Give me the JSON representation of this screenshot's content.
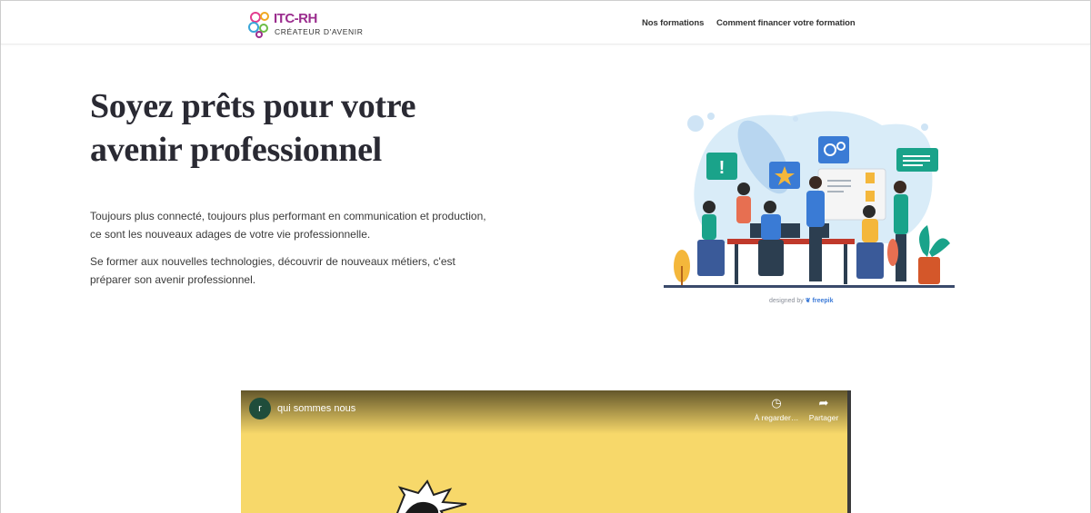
{
  "header": {
    "logo_text": "ITC-RH",
    "logo_tagline": "CRÉATEUR D'AVENIR",
    "nav": [
      {
        "label": "Nos formations"
      },
      {
        "label": "Comment financer votre formation"
      }
    ]
  },
  "hero": {
    "title_line1": "Soyez prêts pour votre",
    "title_line2": "avenir professionnel",
    "paragraph1": "Toujours plus connecté, toujours plus performant en communication et production, ce sont les nouveaux adages de votre vie professionnelle.",
    "paragraph2": "Se former aux nouvelles technologies, découvrir de nouveaux métiers, c'est préparer son avenir professionnel.",
    "image_credit_prefix": "designed by",
    "image_credit_brand": "freepik"
  },
  "video": {
    "channel_initial": "r",
    "title": "qui sommes nous",
    "watch_later_label": "À regarder…",
    "share_label": "Partager"
  },
  "colors": {
    "title": "#2a2a33",
    "video_background": "#f7d86a",
    "logo_purple": "#9b2d8e"
  }
}
